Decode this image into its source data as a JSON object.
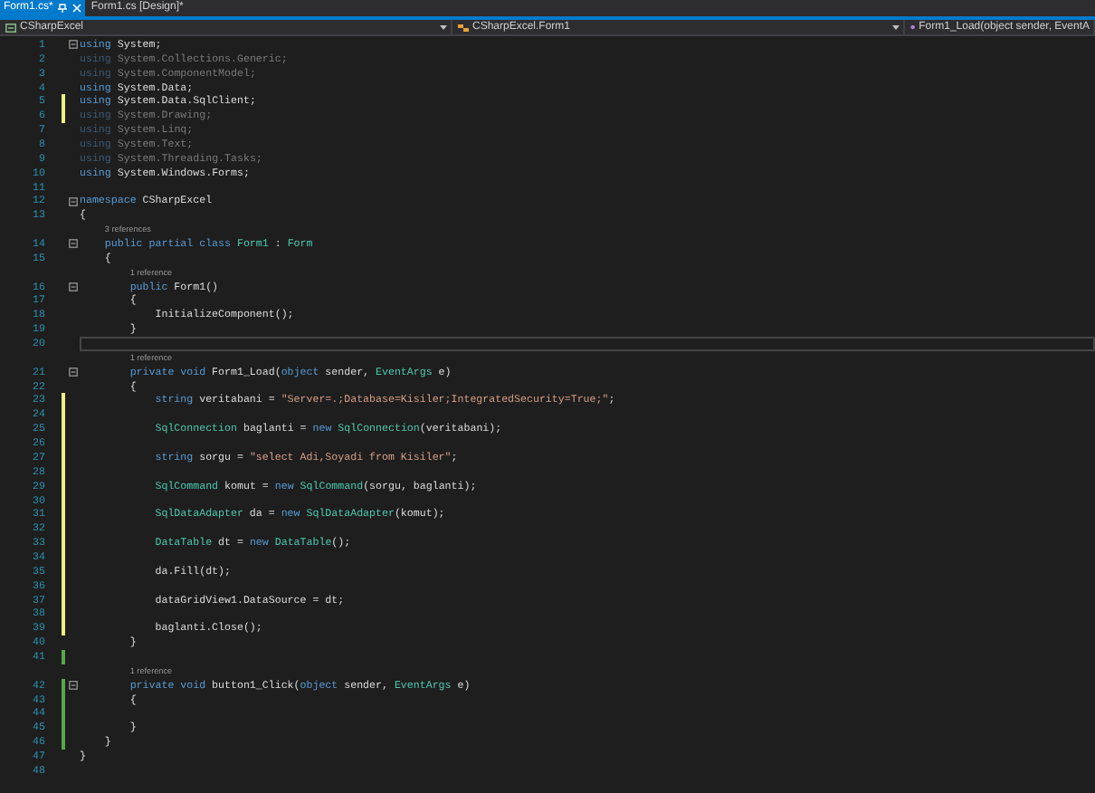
{
  "tabs": [
    {
      "label": "Form1.cs*",
      "selected": true
    },
    {
      "label": "Form1.cs [Design]*",
      "selected": false
    }
  ],
  "nav_bar": {
    "project": "CSharpExcel",
    "class": "CSharpExcel.Form1",
    "member": "Form1_Load(object sender, EventA"
  },
  "lines": [
    {
      "kind": "code",
      "number": "1",
      "changed": false,
      "fold": true,
      "faded": false,
      "current": false,
      "segments": [
        {
          "kind": "keyword",
          "text": "using"
        },
        {
          "kind": "plain",
          "text": " System;"
        }
      ]
    },
    {
      "kind": "code",
      "number": "2",
      "changed": false,
      "fold": false,
      "faded": true,
      "current": false,
      "segments": [
        {
          "kind": "keyword",
          "text": "using"
        },
        {
          "kind": "plain",
          "text": " System.Collections.Generic;"
        }
      ]
    },
    {
      "kind": "code",
      "number": "3",
      "changed": false,
      "fold": false,
      "faded": true,
      "current": false,
      "segments": [
        {
          "kind": "keyword",
          "text": "using"
        },
        {
          "kind": "plain",
          "text": " System.ComponentModel;"
        }
      ]
    },
    {
      "kind": "code",
      "number": "4",
      "changed": false,
      "fold": false,
      "faded": false,
      "current": false,
      "segments": [
        {
          "kind": "keyword",
          "text": "using"
        },
        {
          "kind": "plain",
          "text": " System.Data;"
        }
      ]
    },
    {
      "kind": "code",
      "number": "5",
      "changed": true,
      "saved": false,
      "fold": false,
      "faded": false,
      "current": false,
      "segments": [
        {
          "kind": "keyword",
          "text": "using"
        },
        {
          "kind": "plain",
          "text": " System.Data.SqlClient;"
        }
      ]
    },
    {
      "kind": "code",
      "number": "6",
      "changed": true,
      "saved": false,
      "fold": false,
      "faded": true,
      "current": false,
      "segments": [
        {
          "kind": "keyword",
          "text": "using"
        },
        {
          "kind": "plain",
          "text": " System.Drawing;"
        }
      ]
    },
    {
      "kind": "code",
      "number": "7",
      "changed": false,
      "fold": false,
      "faded": true,
      "current": false,
      "segments": [
        {
          "kind": "keyword",
          "text": "using"
        },
        {
          "kind": "plain",
          "text": " System.Linq;"
        }
      ]
    },
    {
      "kind": "code",
      "number": "8",
      "changed": false,
      "fold": false,
      "faded": true,
      "current": false,
      "segments": [
        {
          "kind": "keyword",
          "text": "using"
        },
        {
          "kind": "plain",
          "text": " System.Text;"
        }
      ]
    },
    {
      "kind": "code",
      "number": "9",
      "changed": false,
      "fold": false,
      "faded": true,
      "current": false,
      "segments": [
        {
          "kind": "keyword",
          "text": "using"
        },
        {
          "kind": "plain",
          "text": " System.Threading.Tasks;"
        }
      ]
    },
    {
      "kind": "code",
      "number": "10",
      "changed": false,
      "fold": false,
      "faded": false,
      "current": false,
      "segments": [
        {
          "kind": "keyword",
          "text": "using"
        },
        {
          "kind": "plain",
          "text": " System.Windows.Forms;"
        }
      ]
    },
    {
      "kind": "code",
      "number": "11",
      "changed": false,
      "fold": false,
      "faded": false,
      "current": false
    },
    {
      "kind": "code",
      "number": "12",
      "changed": false,
      "fold": true,
      "faded": false,
      "current": false,
      "segments": [
        {
          "kind": "keyword",
          "text": "namespace"
        },
        {
          "kind": "plain",
          "text": " CSharpExcel"
        }
      ]
    },
    {
      "kind": "code",
      "number": "13",
      "changed": false,
      "fold": false,
      "faded": false,
      "current": false,
      "segments": [
        {
          "kind": "plain",
          "text": "{"
        }
      ],
      "children": [
        {
          "kind": "codelens",
          "text": "3 references"
        },
        {
          "kind": "code",
          "number": "14",
          "changed": false,
          "fold": true,
          "faded": false,
          "current": false,
          "segments": [
            {
              "kind": "keyword",
              "text": "public partial class "
            },
            {
              "kind": "type",
              "text": "Form1"
            },
            {
              "kind": "plain",
              "text": " : "
            },
            {
              "kind": "type",
              "text": "Form"
            }
          ]
        },
        {
          "kind": "code",
          "number": "15",
          "changed": false,
          "fold": false,
          "faded": false,
          "current": false,
          "segments": [
            {
              "kind": "plain",
              "text": "{"
            }
          ],
          "children": [
            {
              "kind": "codelens",
              "text": "1 reference"
            },
            {
              "kind": "code",
              "number": "16",
              "changed": false,
              "fold": true,
              "faded": false,
              "current": false,
              "segments": [
                {
                  "kind": "keyword",
                  "text": "public"
                },
                {
                  "kind": "plain",
                  "text": " Form1()"
                }
              ]
            },
            {
              "kind": "code",
              "number": "17",
              "changed": false,
              "fold": false,
              "faded": false,
              "current": false,
              "segments": [
                {
                  "kind": "plain",
                  "text": "{"
                }
              ],
              "children": [
                {
                  "kind": "code",
                  "number": "18",
                  "changed": false,
                  "fold": false,
                  "faded": false,
                  "current": false,
                  "segments": [
                    {
                      "kind": "plain",
                      "text": "InitializeComponent();"
                    }
                  ]
                }
              ]
            },
            {
              "kind": "code",
              "number": "19",
              "changed": false,
              "fold": false,
              "faded": false,
              "current": false,
              "segments": [
                {
                  "kind": "plain",
                  "text": "}"
                }
              ]
            },
            {
              "kind": "code",
              "number": "20",
              "changed": false,
              "fold": false,
              "faded": false,
              "current": true
            },
            {
              "kind": "codelens",
              "text": "1 reference"
            },
            {
              "kind": "code",
              "number": "21",
              "changed": false,
              "fold": true,
              "faded": false,
              "current": false,
              "segments": [
                {
                  "kind": "keyword",
                  "text": "private void"
                },
                {
                  "kind": "plain",
                  "text": " Form1_Load("
                },
                {
                  "kind": "keyword",
                  "text": "object"
                },
                {
                  "kind": "plain",
                  "text": " sender, "
                },
                {
                  "kind": "type",
                  "text": "EventArgs"
                },
                {
                  "kind": "plain",
                  "text": " e)"
                }
              ]
            },
            {
              "kind": "code",
              "number": "22",
              "changed": false,
              "fold": false,
              "faded": false,
              "current": false,
              "segments": [
                {
                  "kind": "plain",
                  "text": "{"
                }
              ],
              "children": [
                {
                  "kind": "code",
                  "number": "23",
                  "changed": true,
                  "saved": false,
                  "fold": false,
                  "faded": false,
                  "current": false,
                  "segments": [
                    {
                      "kind": "keyword",
                      "text": "string"
                    },
                    {
                      "kind": "plain",
                      "text": " veritabani = "
                    },
                    {
                      "kind": "string",
                      "text": "\"Server=.;Database=Kisiler;IntegratedSecurity=True;\""
                    },
                    {
                      "kind": "plain",
                      "text": ";"
                    }
                  ]
                },
                {
                  "kind": "code",
                  "number": "24",
                  "changed": true,
                  "saved": false,
                  "fold": false,
                  "faded": false,
                  "current": false
                },
                {
                  "kind": "code",
                  "number": "25",
                  "changed": true,
                  "saved": false,
                  "fold": false,
                  "faded": false,
                  "current": false,
                  "segments": [
                    {
                      "kind": "type",
                      "text": "SqlConnection"
                    },
                    {
                      "kind": "plain",
                      "text": " baglanti = "
                    },
                    {
                      "kind": "keyword",
                      "text": "new "
                    },
                    {
                      "kind": "type",
                      "text": "SqlConnection"
                    },
                    {
                      "kind": "plain",
                      "text": "(veritabani);"
                    }
                  ]
                },
                {
                  "kind": "code",
                  "number": "26",
                  "changed": true,
                  "saved": false,
                  "fold": false,
                  "faded": false,
                  "current": false
                },
                {
                  "kind": "code",
                  "number": "27",
                  "changed": true,
                  "saved": false,
                  "fold": false,
                  "faded": false,
                  "current": false,
                  "segments": [
                    {
                      "kind": "keyword",
                      "text": "string"
                    },
                    {
                      "kind": "plain",
                      "text": " sorgu = "
                    },
                    {
                      "kind": "string",
                      "text": "\"select Adi,Soyadi from Kisiler\""
                    },
                    {
                      "kind": "plain",
                      "text": ";"
                    }
                  ]
                },
                {
                  "kind": "code",
                  "number": "28",
                  "changed": true,
                  "saved": false,
                  "fold": false,
                  "faded": false,
                  "current": false
                },
                {
                  "kind": "code",
                  "number": "29",
                  "changed": true,
                  "saved": false,
                  "fold": false,
                  "faded": false,
                  "current": false,
                  "segments": [
                    {
                      "kind": "type",
                      "text": "SqlCommand"
                    },
                    {
                      "kind": "plain",
                      "text": " komut = "
                    },
                    {
                      "kind": "keyword",
                      "text": "new "
                    },
                    {
                      "kind": "type",
                      "text": "SqlCommand"
                    },
                    {
                      "kind": "plain",
                      "text": "(sorgu, baglanti);"
                    }
                  ]
                },
                {
                  "kind": "code",
                  "number": "30",
                  "changed": true,
                  "saved": false,
                  "fold": false,
                  "faded": false,
                  "current": false
                },
                {
                  "kind": "code",
                  "number": "31",
                  "changed": true,
                  "saved": false,
                  "fold": false,
                  "faded": false,
                  "current": false,
                  "segments": [
                    {
                      "kind": "type",
                      "text": "SqlDataAdapter"
                    },
                    {
                      "kind": "plain",
                      "text": " da = "
                    },
                    {
                      "kind": "keyword",
                      "text": "new "
                    },
                    {
                      "kind": "type",
                      "text": "SqlDataAdapter"
                    },
                    {
                      "kind": "plain",
                      "text": "(komut);"
                    }
                  ]
                },
                {
                  "kind": "code",
                  "number": "32",
                  "changed": true,
                  "saved": false,
                  "fold": false,
                  "faded": false,
                  "current": false
                },
                {
                  "kind": "code",
                  "number": "33",
                  "changed": true,
                  "saved": false,
                  "fold": false,
                  "faded": false,
                  "current": false,
                  "segments": [
                    {
                      "kind": "type",
                      "text": "DataTable"
                    },
                    {
                      "kind": "plain",
                      "text": " dt = "
                    },
                    {
                      "kind": "keyword",
                      "text": "new "
                    },
                    {
                      "kind": "type",
                      "text": "DataTable"
                    },
                    {
                      "kind": "plain",
                      "text": "();"
                    }
                  ]
                },
                {
                  "kind": "code",
                  "number": "34",
                  "changed": true,
                  "saved": false,
                  "fold": false,
                  "faded": false,
                  "current": false
                },
                {
                  "kind": "code",
                  "number": "35",
                  "changed": true,
                  "saved": false,
                  "fold": false,
                  "faded": false,
                  "current": false,
                  "segments": [
                    {
                      "kind": "plain",
                      "text": "da.Fill(dt);"
                    }
                  ]
                },
                {
                  "kind": "code",
                  "number": "36",
                  "changed": true,
                  "saved": false,
                  "fold": false,
                  "faded": false,
                  "current": false
                },
                {
                  "kind": "code",
                  "number": "37",
                  "changed": true,
                  "saved": false,
                  "fold": false,
                  "faded": false,
                  "current": false,
                  "segments": [
                    {
                      "kind": "plain",
                      "text": "dataGridView1.DataSource = dt;"
                    }
                  ]
                },
                {
                  "kind": "code",
                  "number": "38",
                  "changed": true,
                  "saved": false,
                  "fold": false,
                  "faded": false,
                  "current": false
                },
                {
                  "kind": "code",
                  "number": "39",
                  "changed": true,
                  "saved": false,
                  "fold": false,
                  "faded": false,
                  "current": false,
                  "segments": [
                    {
                      "kind": "plain",
                      "text": "baglanti.Close();"
                    }
                  ]
                }
              ]
            },
            {
              "kind": "code",
              "number": "40",
              "changed": false,
              "fold": false,
              "faded": false,
              "current": false,
              "segments": [
                {
                  "kind": "plain",
                  "text": "}"
                }
              ]
            },
            {
              "kind": "code",
              "number": "41",
              "changed": true,
              "saved": true,
              "fold": false,
              "faded": false,
              "current": false
            },
            {
              "kind": "codelens",
              "text": "1 reference"
            },
            {
              "kind": "code",
              "number": "42",
              "changed": true,
              "saved": true,
              "fold": true,
              "faded": false,
              "current": false,
              "segments": [
                {
                  "kind": "keyword",
                  "text": "private void"
                },
                {
                  "kind": "plain",
                  "text": " button1_Click("
                },
                {
                  "kind": "keyword",
                  "text": "object"
                },
                {
                  "kind": "plain",
                  "text": " sender, "
                },
                {
                  "kind": "type",
                  "text": "EventArgs"
                },
                {
                  "kind": "plain",
                  "text": " e)"
                }
              ]
            },
            {
              "kind": "code",
              "number": "43",
              "changed": true,
              "saved": true,
              "fold": false,
              "faded": false,
              "current": false,
              "segments": [
                {
                  "kind": "plain",
                  "text": "{"
                }
              ],
              "children": [
                {
                  "kind": "code",
                  "number": "44",
                  "changed": true,
                  "saved": true,
                  "fold": false,
                  "faded": false,
                  "current": false
                }
              ]
            },
            {
              "kind": "code",
              "number": "45",
              "changed": true,
              "saved": true,
              "fold": false,
              "faded": false,
              "current": false,
              "segments": [
                {
                  "kind": "plain",
                  "text": "}"
                }
              ]
            }
          ]
        },
        {
          "kind": "code",
          "number": "46",
          "changed": true,
          "saved": true,
          "fold": false,
          "faded": false,
          "current": false,
          "segments": [
            {
              "kind": "plain",
              "text": "}"
            }
          ]
        }
      ]
    },
    {
      "kind": "code",
      "number": "47",
      "changed": false,
      "fold": false,
      "faded": false,
      "current": false,
      "segments": [
        {
          "kind": "plain",
          "text": "}"
        }
      ]
    },
    {
      "kind": "code",
      "number": "48",
      "changed": false,
      "fold": false,
      "faded": false,
      "current": false
    }
  ]
}
